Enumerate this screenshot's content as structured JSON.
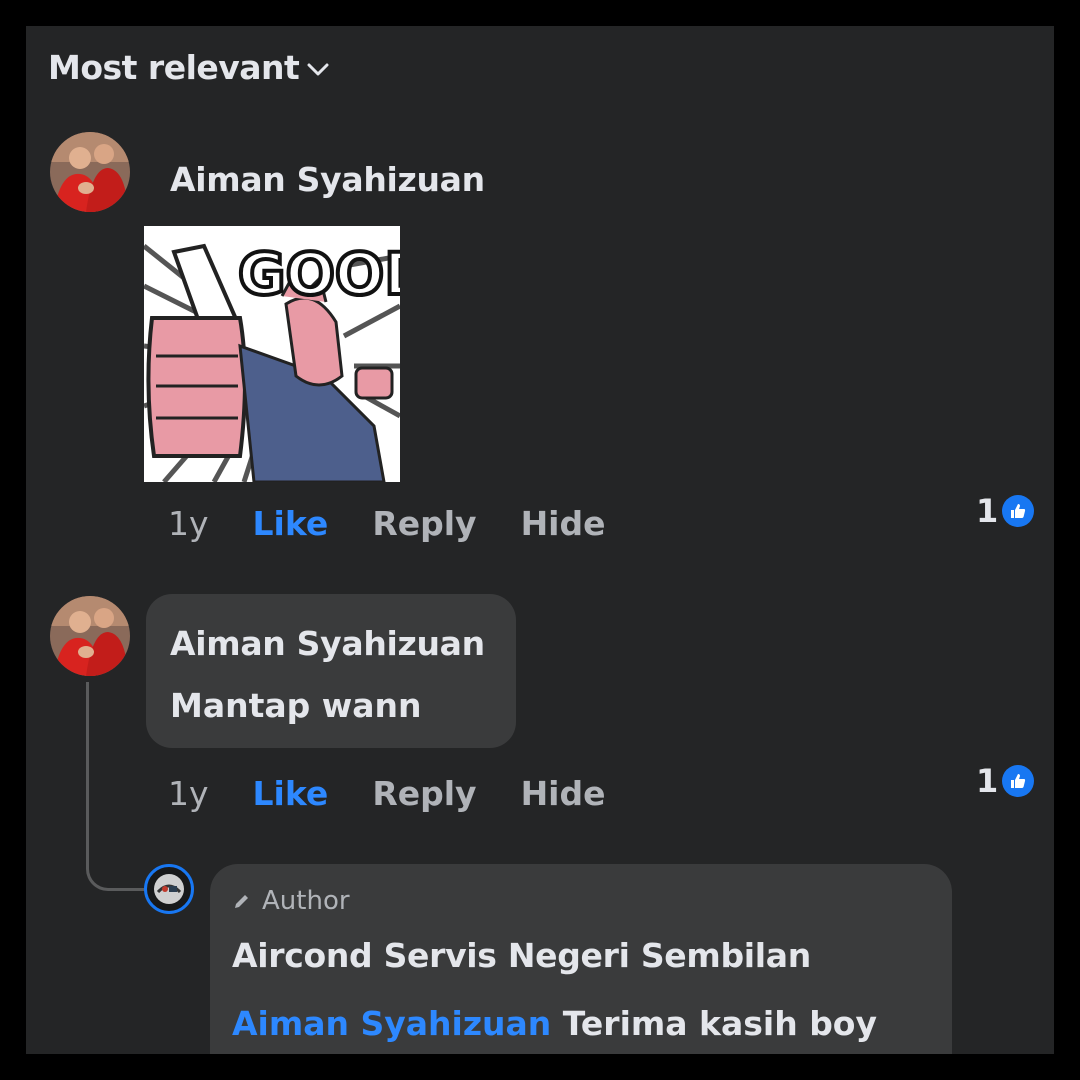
{
  "sort": {
    "label": "Most relevant"
  },
  "comments": [
    {
      "author": "Aiman Syahizuan",
      "sticker_text": "GOOD",
      "time": "1y",
      "like": "Like",
      "reply": "Reply",
      "hide": "Hide",
      "reaction_count": "1"
    },
    {
      "author": "Aiman Syahizuan",
      "text": "Mantap wann",
      "time": "1y",
      "like": "Like",
      "reply": "Reply",
      "hide": "Hide",
      "reaction_count": "1",
      "reply_item": {
        "badge": "Author",
        "author": "Aircond Servis Negeri Sembilan",
        "mention": "Aiman Syahizuan",
        "text": " Terima kasih boy"
      }
    }
  ],
  "colors": {
    "like": "#2d88ff",
    "panel": "#242526",
    "bubble": "#3a3b3c"
  }
}
